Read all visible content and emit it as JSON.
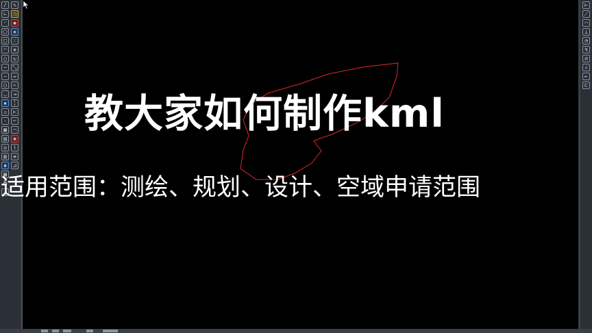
{
  "overlay": {
    "title": "教大家如何制作kml",
    "subtitle": "适用范围：测绘、规划、设计、空域申请范围"
  },
  "toolbar_left": {
    "letter_label": "A"
  },
  "colors": {
    "background": "#000000",
    "polyline": "#e0282a",
    "toolbar": "#2b2f36",
    "text": "#ffffff"
  },
  "icons": {
    "cursor": "mouse-pointer-icon"
  }
}
